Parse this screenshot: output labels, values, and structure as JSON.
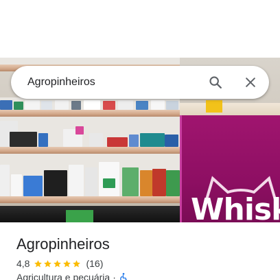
{
  "search": {
    "query": "Agropinheiros",
    "search_icon": "search-icon",
    "close_icon": "close-icon"
  },
  "photo": {
    "brand_text": "Whisk"
  },
  "place": {
    "name": "Agropinheiros",
    "rating": "4,8",
    "stars": 5,
    "review_count": "(16)",
    "category": "Agricultura e pecuária",
    "separator": "·",
    "accessibility_icon": "wheelchair-icon"
  },
  "colors": {
    "star": "#fbbc04",
    "display_magenta": "#a0156f",
    "accessibility_blue": "#1a73e8"
  }
}
